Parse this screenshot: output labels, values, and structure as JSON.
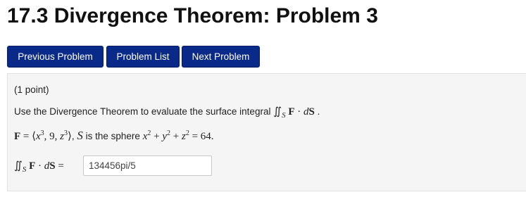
{
  "page": {
    "title": "17.3 Divergence Theorem: Problem 3"
  },
  "nav": {
    "previous_label": "Previous Problem",
    "list_label": "Problem List",
    "next_label": "Next Problem"
  },
  "problem": {
    "points": "(1 point)",
    "instruction": "Use the Divergence Theorem to evaluate the surface integral",
    "integral_expression": "∬S F · dS",
    "field_definition": "F = ⟨x³, 9, z³⟩",
    "surface_description": "S is the sphere x² + y² + z² = 64.",
    "answer_value": "134456pi/5"
  },
  "colors": {
    "button_bg": "#0a2a8a",
    "panel_bg": "#f5f5f5"
  }
}
